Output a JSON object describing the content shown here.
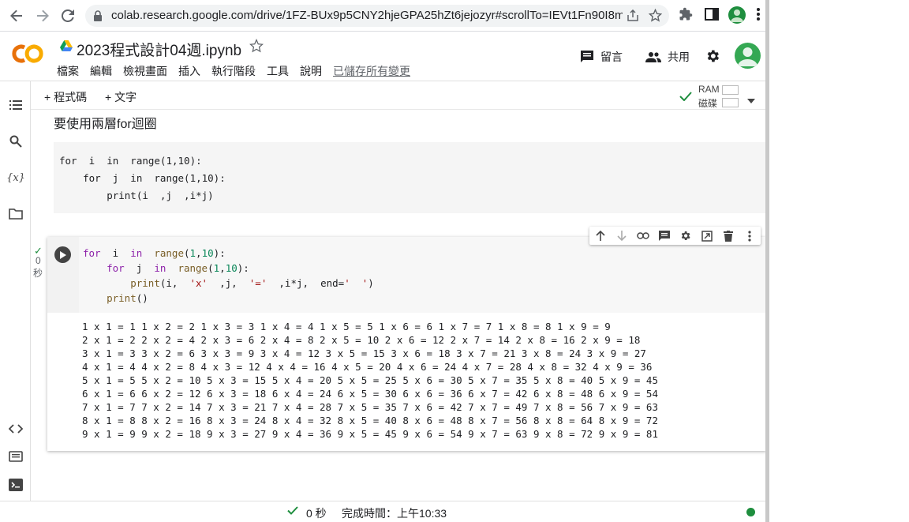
{
  "browser": {
    "url": "colab.research.google.com/drive/1FZ-BUx9p5CNY2hjeGPA25hZt6jejozyr#scrollTo=IEVt1Fn90I8m"
  },
  "header": {
    "title": "2023程式設計04週.ipynb",
    "menu": [
      "檔案",
      "編輯",
      "檢視畫面",
      "插入",
      "執行階段",
      "工具",
      "說明"
    ],
    "saved_status": "已儲存所有變更",
    "comment_label": "留言",
    "share_label": "共用"
  },
  "toolbar": {
    "add_code": "+ 程式碼",
    "add_text": "+ 文字",
    "ram_label": "RAM",
    "disk_label": "磁碟"
  },
  "text_cell": {
    "text": "要使用兩層for迴圈",
    "code_lines": [
      "for  i  in  range(1,10):",
      "    for  j  in  range(1,10):",
      "        print(i  ,j  ,i*j)"
    ]
  },
  "code_cell": {
    "exec_check": "✓",
    "exec_seconds": "0",
    "exec_unit": "秒",
    "output_lines": [
      "1 x 1 = 1 1 x 2 = 2 1 x 3 = 3 1 x 4 = 4 1 x 5 = 5 1 x 6 = 6 1 x 7 = 7 1 x 8 = 8 1 x 9 = 9",
      "2 x 1 = 2 2 x 2 = 4 2 x 3 = 6 2 x 4 = 8 2 x 5 = 10 2 x 6 = 12 2 x 7 = 14 2 x 8 = 16 2 x 9 = 18",
      "3 x 1 = 3 3 x 2 = 6 3 x 3 = 9 3 x 4 = 12 3 x 5 = 15 3 x 6 = 18 3 x 7 = 21 3 x 8 = 24 3 x 9 = 27",
      "4 x 1 = 4 4 x 2 = 8 4 x 3 = 12 4 x 4 = 16 4 x 5 = 20 4 x 6 = 24 4 x 7 = 28 4 x 8 = 32 4 x 9 = 36",
      "5 x 1 = 5 5 x 2 = 10 5 x 3 = 15 5 x 4 = 20 5 x 5 = 25 5 x 6 = 30 5 x 7 = 35 5 x 8 = 40 5 x 9 = 45",
      "6 x 1 = 6 6 x 2 = 12 6 x 3 = 18 6 x 4 = 24 6 x 5 = 30 6 x 6 = 36 6 x 7 = 42 6 x 8 = 48 6 x 9 = 54",
      "7 x 1 = 7 7 x 2 = 14 7 x 3 = 21 7 x 4 = 28 7 x 5 = 35 7 x 6 = 42 7 x 7 = 49 7 x 8 = 56 7 x 9 = 63",
      "8 x 1 = 8 8 x 2 = 16 8 x 3 = 24 8 x 4 = 32 8 x 5 = 40 8 x 6 = 48 8 x 7 = 56 8 x 8 = 64 8 x 9 = 72",
      "9 x 1 = 9 9 x 2 = 18 9 x 3 = 27 9 x 4 = 36 9 x 5 = 45 9 x 6 = 54 9 x 7 = 63 9 x 8 = 72 9 x 9 = 81"
    ]
  },
  "status": {
    "check": "✓",
    "seconds": "0 秒",
    "completed": "完成時間：上午10:33"
  },
  "colors": {
    "colab_orange": "#f9ab00",
    "status_green": "#1e8e3e",
    "keyword_purple": "#8e24aa"
  }
}
